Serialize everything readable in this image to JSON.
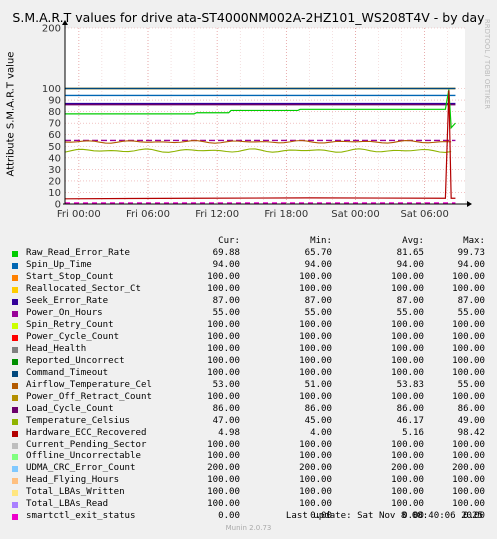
{
  "chart_data": {
    "type": "line",
    "title": "S.M.A.R.T values for drive ata-ST4000NM002A-2HZ101_WS208T4V - by day",
    "ylabel": "Attribute S.M.A.R.T value",
    "xlabel": "",
    "ylim": [
      0,
      200
    ],
    "x_ticks": [
      "Fri 00:00",
      "Fri 06:00",
      "Fri 12:00",
      "Fri 18:00",
      "Sat 00:00",
      "Sat 06:00"
    ],
    "y_ticks": [
      0,
      10,
      20,
      30,
      40,
      50,
      60,
      70,
      80,
      90,
      100,
      200
    ],
    "grid": true,
    "columns": [
      "Cur:",
      "Min:",
      "Avg:",
      "Max:"
    ],
    "series": [
      {
        "name": "Raw_Read_Error_Rate",
        "color": "#00cc00",
        "cur": "69.88",
        "min": "65.70",
        "avg": "81.65",
        "max": "99.73"
      },
      {
        "name": "Spin_Up_Time",
        "color": "#0066b3",
        "cur": "94.00",
        "min": "94.00",
        "avg": "94.00",
        "max": "94.00"
      },
      {
        "name": "Start_Stop_Count",
        "color": "#ff8000",
        "cur": "100.00",
        "min": "100.00",
        "avg": "100.00",
        "max": "100.00"
      },
      {
        "name": "Reallocated_Sector_Ct",
        "color": "#ffcc00",
        "cur": "100.00",
        "min": "100.00",
        "avg": "100.00",
        "max": "100.00"
      },
      {
        "name": "Seek_Error_Rate",
        "color": "#330099",
        "cur": "87.00",
        "min": "87.00",
        "avg": "87.00",
        "max": "87.00"
      },
      {
        "name": "Power_On_Hours",
        "color": "#990099",
        "cur": "55.00",
        "min": "55.00",
        "avg": "55.00",
        "max": "55.00"
      },
      {
        "name": "Spin_Retry_Count",
        "color": "#ccff00",
        "cur": "100.00",
        "min": "100.00",
        "avg": "100.00",
        "max": "100.00"
      },
      {
        "name": "Power_Cycle_Count",
        "color": "#ff0000",
        "cur": "100.00",
        "min": "100.00",
        "avg": "100.00",
        "max": "100.00"
      },
      {
        "name": "Head_Health",
        "color": "#808080",
        "cur": "100.00",
        "min": "100.00",
        "avg": "100.00",
        "max": "100.00"
      },
      {
        "name": "Reported_Uncorrect",
        "color": "#008f00",
        "cur": "100.00",
        "min": "100.00",
        "avg": "100.00",
        "max": "100.00"
      },
      {
        "name": "Command_Timeout",
        "color": "#00487d",
        "cur": "100.00",
        "min": "100.00",
        "avg": "100.00",
        "max": "100.00"
      },
      {
        "name": "Airflow_Temperature_Cel",
        "color": "#b35a00",
        "cur": "53.00",
        "min": "51.00",
        "avg": "53.83",
        "max": "55.00"
      },
      {
        "name": "Power_Off_Retract_Count",
        "color": "#b38f00",
        "cur": "100.00",
        "min": "100.00",
        "avg": "100.00",
        "max": "100.00"
      },
      {
        "name": "Load_Cycle_Count",
        "color": "#6b006b",
        "cur": "86.00",
        "min": "86.00",
        "avg": "86.00",
        "max": "86.00"
      },
      {
        "name": "Temperature_Celsius",
        "color": "#8fb300",
        "cur": "47.00",
        "min": "45.00",
        "avg": "46.17",
        "max": "49.00"
      },
      {
        "name": "Hardware_ECC_Recovered",
        "color": "#b30000",
        "cur": "4.98",
        "min": "4.00",
        "avg": "5.16",
        "max": "98.42"
      },
      {
        "name": "Current_Pending_Sector",
        "color": "#bebebe",
        "cur": "100.00",
        "min": "100.00",
        "avg": "100.00",
        "max": "100.00"
      },
      {
        "name": "Offline_Uncorrectable",
        "color": "#80ff80",
        "cur": "100.00",
        "min": "100.00",
        "avg": "100.00",
        "max": "100.00"
      },
      {
        "name": "UDMA_CRC_Error_Count",
        "color": "#80c9ff",
        "cur": "200.00",
        "min": "200.00",
        "avg": "200.00",
        "max": "200.00"
      },
      {
        "name": "Head_Flying_Hours",
        "color": "#ffc080",
        "cur": "100.00",
        "min": "100.00",
        "avg": "100.00",
        "max": "100.00"
      },
      {
        "name": "Total_LBAs_Written",
        "color": "#ffe680",
        "cur": "100.00",
        "min": "100.00",
        "avg": "100.00",
        "max": "100.00"
      },
      {
        "name": "Total_LBAs_Read",
        "color": "#aa80ff",
        "cur": "100.00",
        "min": "100.00",
        "avg": "100.00",
        "max": "100.00"
      },
      {
        "name": "smartctl_exit_status",
        "color": "#ee00cc",
        "cur": "0.00",
        "min": "0.00",
        "avg": "0.00",
        "max": "0.00"
      }
    ]
  },
  "footer": {
    "last_update": "Last update: Sat Nov  8 08:40:06 2025",
    "version": "Munin 2.0.73"
  },
  "watermark": "RRDTOOL / TOBI OETIKER"
}
